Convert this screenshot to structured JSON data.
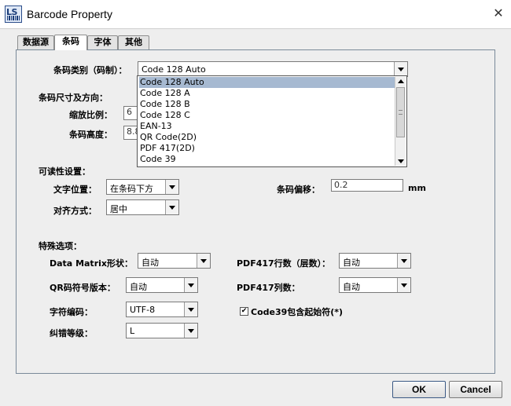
{
  "window": {
    "title": "Barcode Property",
    "icon_text": "LS"
  },
  "tabs": [
    {
      "label": "数据源"
    },
    {
      "label": "条码"
    },
    {
      "label": "字体"
    },
    {
      "label": "其他"
    }
  ],
  "barcode_type": {
    "label": "条码类别（码制）：",
    "value": "Code 128 Auto",
    "options": [
      "Code 128 Auto",
      "Code 128 A",
      "Code 128 B",
      "Code 128 C",
      "EAN-13",
      "QR Code(2D)",
      "PDF 417(2D)",
      "Code 39"
    ]
  },
  "size_section": {
    "heading": "条码尺寸及方向：",
    "scale_label": "缩放比例：",
    "scale_value": "6",
    "height_label": "条码高度：",
    "height_value": "8.8"
  },
  "readability": {
    "heading": "可读性设置：",
    "text_pos_label": "文字位置：",
    "text_pos_value": "在条码下方",
    "align_label": "对齐方式：",
    "align_value": "居中",
    "offset_label": "条码偏移：",
    "offset_value": "0.2",
    "offset_unit": "mm"
  },
  "special": {
    "heading": "特殊选项：",
    "dm_label": "Data Matrix形状：",
    "dm_value": "自动",
    "qr_label": "QR码符号版本：",
    "qr_value": "自动",
    "enc_label": "字符编码：",
    "enc_value": "UTF-8",
    "ec_label": "纠错等级：",
    "ec_value": "L",
    "pdf_rows_label": "PDF417行数（层数）：",
    "pdf_rows_value": "自动",
    "pdf_cols_label": "PDF417列数：",
    "pdf_cols_value": "自动",
    "code39_label": "Code39包含起始符(*)",
    "code39_checked": true,
    "check_mark": "✔"
  },
  "buttons": {
    "ok": "OK",
    "cancel": "Cancel"
  },
  "close_glyph": "✕"
}
